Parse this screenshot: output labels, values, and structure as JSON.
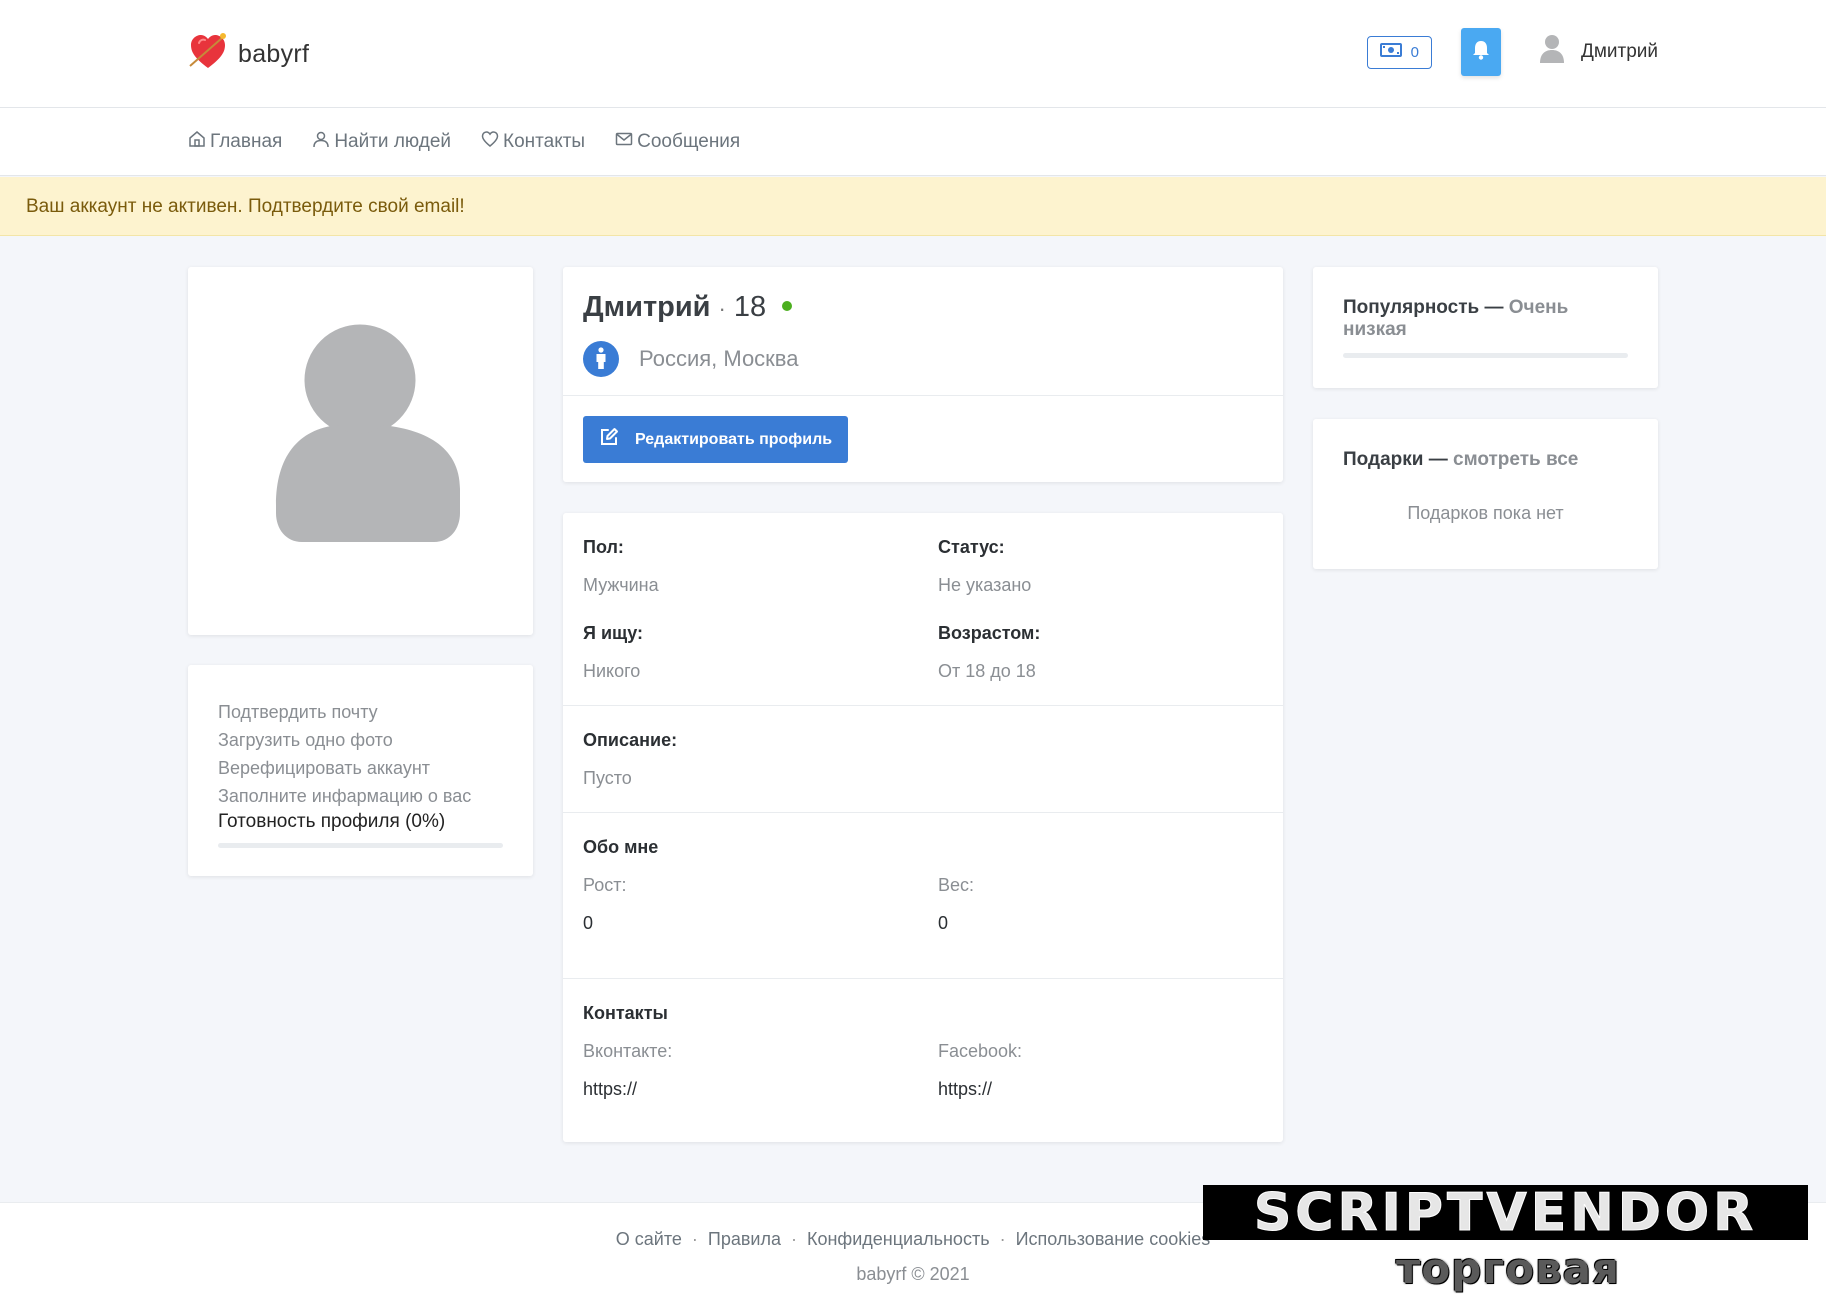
{
  "header": {
    "logo_text": "babyrf",
    "coins": "0",
    "user_name": "Дмитрий"
  },
  "nav": {
    "items": [
      {
        "label": "Главная",
        "icon": "home-icon"
      },
      {
        "label": "Найти людей",
        "icon": "person-icon"
      },
      {
        "label": "Контакты",
        "icon": "heart-icon"
      },
      {
        "label": "Сообщения",
        "icon": "envelope-icon"
      }
    ]
  },
  "alert": {
    "text": "Ваш аккаунт не активен. Подтвердите свой email!"
  },
  "checklist": {
    "items": [
      "Подтвердить почту",
      "Загрузить одно фото",
      "Верефицировать аккаунт",
      "Заполните инфармацию о вас"
    ],
    "readiness": "Готовность профиля (0%)",
    "readiness_fraction": 0
  },
  "profile": {
    "name": "Дмитрий",
    "age": "18",
    "location": "Россия, Москва",
    "edit_label": "Редактировать профиль"
  },
  "details": {
    "gender_label": "Пол:",
    "gender_value": "Мужчина",
    "status_label": "Статус:",
    "status_value": "Не указано",
    "seeking_label": "Я ищу:",
    "seeking_value": "Никого",
    "age_range_label": "Возрастом:",
    "age_range_value": "От 18 до 18",
    "description_label": "Описание:",
    "description_value": "Пусто",
    "about_title": "Обо мне",
    "height_label": "Рост:",
    "height_value": "0",
    "weight_label": "Вес:",
    "weight_value": "0",
    "contacts_title": "Контакты",
    "vk_label": "Вконтакте:",
    "vk_value": "https://",
    "fb_label": "Facebook:",
    "fb_value": "https://"
  },
  "popularity": {
    "label": "Популярность —",
    "value": "Очень низкая",
    "fraction": 0
  },
  "gifts": {
    "label": "Подарки —",
    "link": "смотреть все",
    "empty": "Подарков пока нет"
  },
  "footer": {
    "links": [
      "О сайте",
      "Правила",
      "Конфиденциальность",
      "Использование cookies"
    ],
    "copyright": "babyrf © 2021"
  },
  "watermark": {
    "top": "SCRIPTVENDOR",
    "bottom": "торговая площадка"
  },
  "colors": {
    "accent": "#3a7cd5",
    "bell": "#4aa9f2",
    "online": "#4caf1f",
    "alert_bg": "#fdf3cf"
  }
}
